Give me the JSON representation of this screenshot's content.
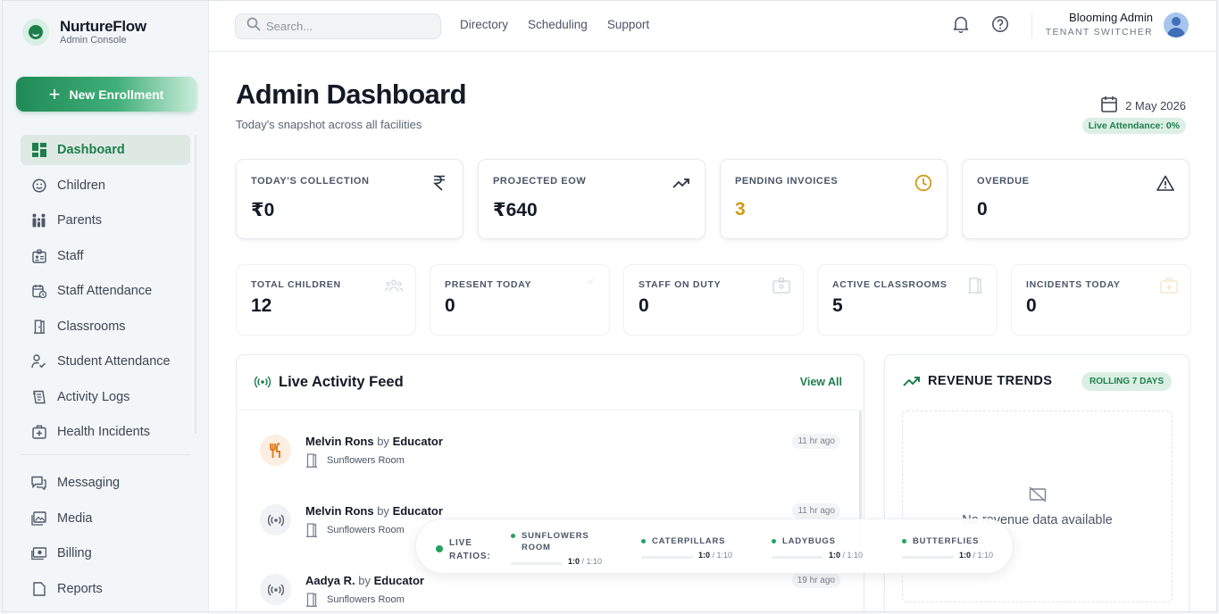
{
  "brand": {
    "name": "NurtureFlow",
    "subtitle": "Admin Console"
  },
  "new_enrollment_label": "New Enrollment",
  "sidebar": {
    "items": [
      {
        "label": "Dashboard",
        "icon": "dashboard-icon",
        "active": true
      },
      {
        "label": "Children",
        "icon": "smile-icon"
      },
      {
        "label": "Parents",
        "icon": "family-icon"
      },
      {
        "label": "Staff",
        "icon": "id-badge-icon"
      },
      {
        "label": "Staff Attendance",
        "icon": "calendar-clock-icon"
      },
      {
        "label": "Classrooms",
        "icon": "door-icon"
      },
      {
        "label": "Student Attendance",
        "icon": "user-check-icon"
      },
      {
        "label": "Activity Logs",
        "icon": "notebook-icon"
      },
      {
        "label": "Health Incidents",
        "icon": "first-aid-icon"
      }
    ],
    "items2": [
      {
        "label": "Messaging",
        "icon": "chat-icon"
      },
      {
        "label": "Media",
        "icon": "photos-icon"
      },
      {
        "label": "Billing",
        "icon": "money-icon"
      },
      {
        "label": "Reports",
        "icon": "reports-icon"
      }
    ]
  },
  "search": {
    "placeholder": "Search..."
  },
  "topnav": [
    "Directory",
    "Scheduling",
    "Support"
  ],
  "user": {
    "name": "Blooming Admin",
    "role": "TENANT SWITCHER"
  },
  "page": {
    "title": "Admin Dashboard",
    "subtitle": "Today's snapshot across all facilities",
    "date": "2 May 2026",
    "live_attendance": "Live Attendance: 0%"
  },
  "kpis": [
    {
      "label": "TODAY'S COLLECTION",
      "value": "₹0",
      "icon": "rupee-icon"
    },
    {
      "label": "PROJECTED EOW",
      "value": "₹640",
      "icon": "trending-up-icon"
    },
    {
      "label": "PENDING INVOICES",
      "value": "3",
      "icon": "clock-icon",
      "color": "#d39a18"
    },
    {
      "label": "OVERDUE",
      "value": "0",
      "icon": "warning-icon"
    }
  ],
  "stats": [
    {
      "label": "TOTAL CHILDREN",
      "value": "12",
      "icon": "group-icon"
    },
    {
      "label": "PRESENT TODAY",
      "value": "0",
      "icon": "check-icon"
    },
    {
      "label": "STAFF ON DUTY",
      "value": "0",
      "icon": "id-badge-icon"
    },
    {
      "label": "ACTIVE CLASSROOMS",
      "value": "5",
      "icon": "door-icon"
    },
    {
      "label": "INCIDENTS TODAY",
      "value": "0",
      "icon": "first-aid-icon"
    }
  ],
  "feed": {
    "title": "Live Activity Feed",
    "view_all": "View All",
    "items": [
      {
        "name": "Melvin Rons",
        "by": "by",
        "role": "Educator",
        "room": "Sunflowers Room",
        "time": "11 hr ago",
        "icon": "meal-icon"
      },
      {
        "name": "Melvin Rons",
        "by": "by",
        "role": "Educator",
        "room": "Sunflowers Room",
        "time": "11 hr ago",
        "icon": "broadcast-icon"
      },
      {
        "name": "Aadya R.",
        "by": "by",
        "role": "Educator",
        "room": "Sunflowers Room",
        "time": "19 hr ago",
        "icon": "broadcast-icon"
      }
    ]
  },
  "revenue": {
    "title": "REVENUE TRENDS",
    "badge": "ROLLING 7 DAYS",
    "empty": "No revenue data available"
  },
  "ratios": {
    "label_line1": "LIVE",
    "label_line2": "RATIOS:",
    "rooms": [
      {
        "name": "SUNFLOWERS ROOM",
        "current": "1:0",
        "target": "1:10"
      },
      {
        "name": "CATERPILLARS",
        "current": "1:0",
        "target": "1:10"
      },
      {
        "name": "LADYBUGS",
        "current": "1:0",
        "target": "1:10"
      },
      {
        "name": "BUTTERFLIES",
        "current": "1:0",
        "target": "1:10"
      }
    ]
  }
}
